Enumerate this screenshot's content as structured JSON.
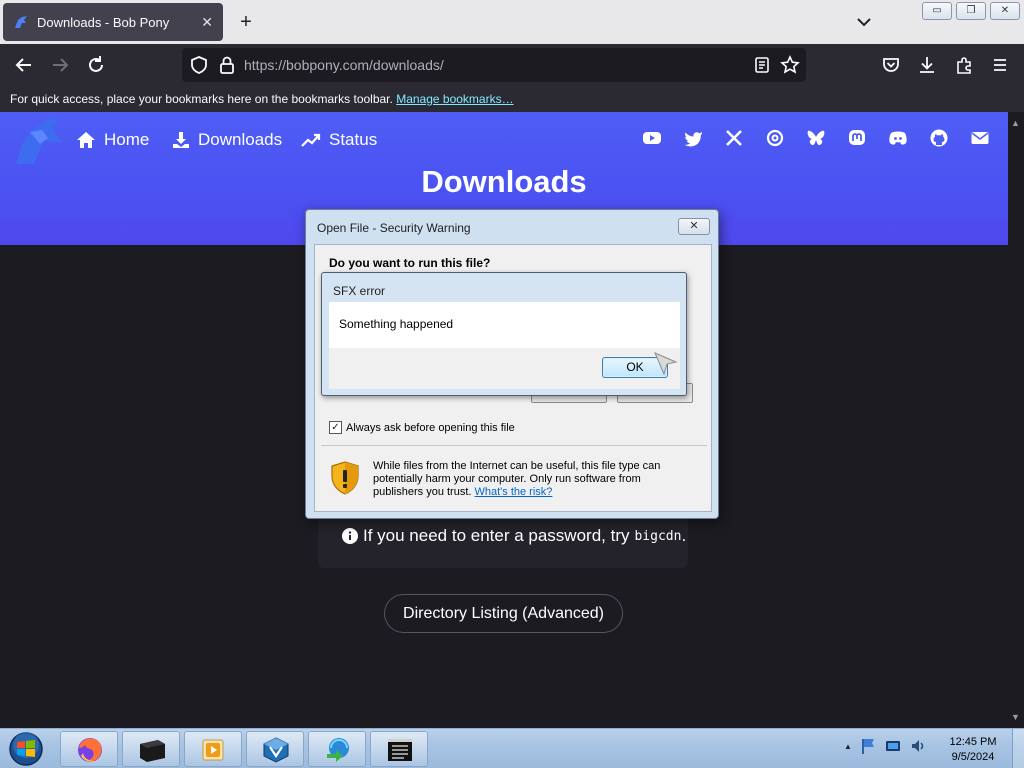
{
  "browser": {
    "tab_title": "Downloads - Bob Pony",
    "tab_close": "✕",
    "new_tab": "+",
    "url_host": "https://bobpony.com",
    "url_path": "/downloads/",
    "bookmarks_hint": "For quick access, place your bookmarks here on the bookmarks toolbar.",
    "manage_bookmarks": "Manage bookmarks…",
    "window_buttons": {
      "minimize": "▭",
      "restore": "❐",
      "close": "✕"
    }
  },
  "site": {
    "nav": [
      {
        "label": "Home",
        "icon": "home-icon"
      },
      {
        "label": "Downloads",
        "icon": "download-icon"
      },
      {
        "label": "Status",
        "icon": "trend-icon"
      }
    ],
    "socials": [
      "youtube-icon",
      "twitter-icon",
      "x-icon",
      "threads-icon",
      "bluesky-icon",
      "mastodon-icon",
      "discord-icon",
      "github-icon",
      "email-icon"
    ],
    "page_title": "Downloads",
    "password_hint": "If you need to enter a password, try",
    "password_code": "bigcdn",
    "password_end": ".",
    "directory_button": "Directory Listing (Advanced)"
  },
  "security_dialog": {
    "title": "Open File - Security Warning",
    "close": "✕",
    "question": "Do you want to run this file?",
    "checkbox_mark": "✓",
    "checkbox_label": "Always ask before opening this file",
    "warning_text": "While files from the Internet can be useful, this file type can potentially harm your computer. Only run software from publishers you trust.",
    "risk_link": "What's the risk?"
  },
  "sfx_dialog": {
    "title": "SFX error",
    "message": "Something happened",
    "ok": "OK"
  },
  "taskbar": {
    "apps": [
      "firefox-icon",
      "terminal-icon",
      "media-player-icon",
      "virtualbox-icon",
      "download-manager-icon",
      "console-icon"
    ],
    "tray_arrow": "▲",
    "time": "12:45 PM",
    "date": "9/5/2024"
  },
  "colors": {
    "hero_blue": "#4f5df5",
    "chrome_dark": "#2b2a33",
    "page_bg": "#1c1b22",
    "link_cyan": "#80ebff"
  }
}
